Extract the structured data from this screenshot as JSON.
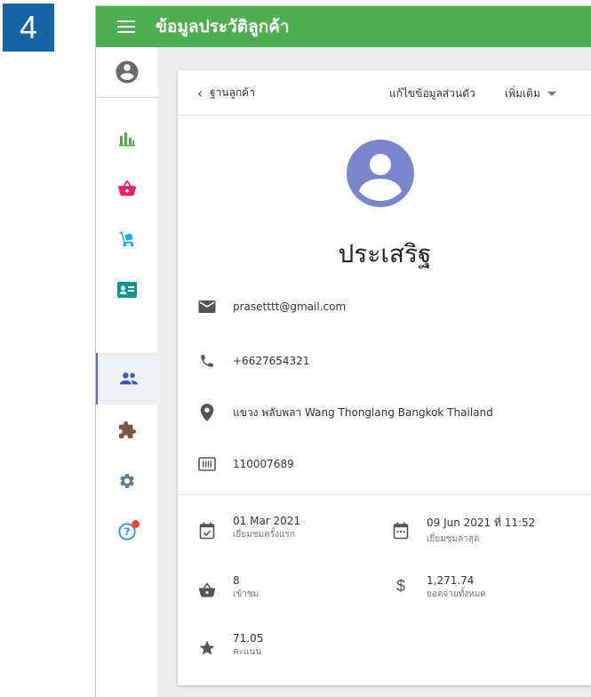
{
  "step_badge": "4",
  "app": {
    "title": "ข้อมูลประวัติลูกค้า"
  },
  "sidebar": {
    "items": [
      {
        "icon": "account-circle-icon"
      },
      {
        "icon": "bar-chart-icon",
        "color": "#4caf50"
      },
      {
        "icon": "basket-icon",
        "color": "#e91e63"
      },
      {
        "icon": "hand-truck-icon",
        "color": "#03a9f4"
      },
      {
        "icon": "contact-card-icon",
        "color": "#009688"
      },
      {
        "icon": "people-icon",
        "color": "#3f51b5",
        "active": true
      },
      {
        "icon": "puzzle-icon",
        "color": "#795548"
      },
      {
        "icon": "gear-icon",
        "color": "#607d8b"
      },
      {
        "icon": "help-icon",
        "color": "#2196f3",
        "badge_color": "#f44336"
      }
    ]
  },
  "header": {
    "back_label": "ฐานลูกค้า",
    "edit_label": "แก้ไขข้อมูลส่วนตัว",
    "more_label": "เพิ่มเติม"
  },
  "customer": {
    "name": "ประเสริฐ",
    "email": "prasetttt@gmail.com",
    "phone": "+6627654321",
    "address": "แขวง พลับพลา Wang Thonglang Bangkok Thailand",
    "barcode": "110007689"
  },
  "stats": {
    "first_visit": {
      "value": "01 Mar 2021",
      "label": "เยี่ยมชมครั้งแรก"
    },
    "last_visit": {
      "value": "09 Jun 2021 ที่ 11:52",
      "label": "เยี่ยมชมล่าสุด"
    },
    "visits": {
      "value": "8",
      "label": "เข้าชม"
    },
    "total_spend": {
      "value": "1,271.74",
      "label": "ยอดจ่ายทั้งหมด"
    },
    "points": {
      "value": "71.05",
      "label": "คะแนน"
    }
  },
  "colors": {
    "topbar": "#4caf50",
    "badge": "#1565a6",
    "avatar": "#7986cb"
  }
}
